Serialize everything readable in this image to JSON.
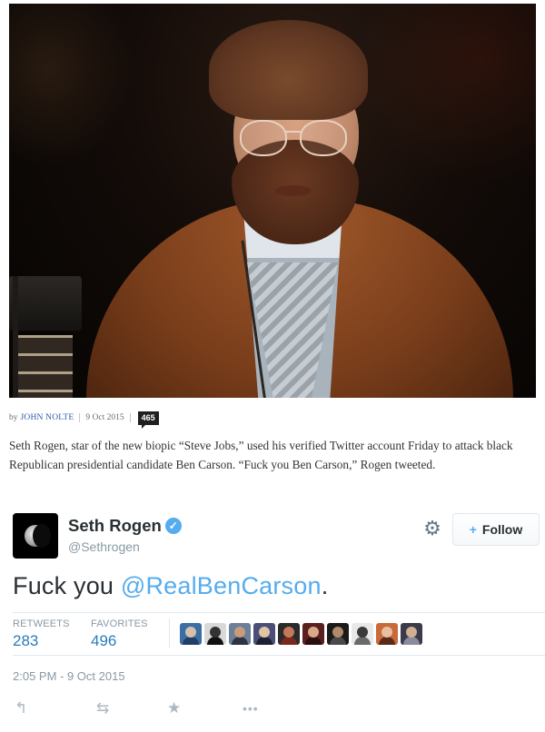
{
  "article": {
    "byline_prefix": "by",
    "author": "JOHN NOLTE",
    "date": "9 Oct 2015",
    "comment_count": "465",
    "body": "Seth Rogen, star of the new biopic “Steve Jobs,” used his verified Twitter account Friday to attack black Republican presidential candidate Ben Carson. “Fuck you Ben Carson,” Rogen tweeted."
  },
  "tweet": {
    "display_name": "Seth Rogen",
    "verified_glyph": "✓",
    "handle": "@Sethrogen",
    "follow_label": "Follow",
    "follow_icon": "+",
    "gear_glyph": "⚙",
    "text_before": "Fuck you ",
    "mention": "@RealBenCarson",
    "text_after": ".",
    "retweets_label": "RETWEETS",
    "retweets": "283",
    "favorites_label": "FAVORITES",
    "favorites": "496",
    "timestamp": "2:05 PM - 9 Oct 2015",
    "actions": {
      "reply_glyph": "↰",
      "retweet_glyph": "⇆",
      "favorite_glyph": "★",
      "more_glyph": "•••"
    }
  },
  "favoriter_avatars": [
    {
      "name": "favoriter-avatar-1",
      "bg": "#3a6ea5",
      "head": "#d8c0a8",
      "body": "#1f3f66"
    },
    {
      "name": "favoriter-avatar-2",
      "bg": "#d9d9d9",
      "head": "#333333",
      "body": "#111111"
    },
    {
      "name": "favoriter-avatar-3",
      "bg": "#6b7f99",
      "head": "#c99b7a",
      "body": "#2b3440"
    },
    {
      "name": "favoriter-avatar-4",
      "bg": "#4a4f7a",
      "head": "#e0c4a4",
      "body": "#1d2033"
    },
    {
      "name": "favoriter-avatar-5",
      "bg": "#2b2b2b",
      "head": "#c47a5a",
      "body": "#7a2a1a"
    },
    {
      "name": "favoriter-avatar-6",
      "bg": "#5a1f1f",
      "head": "#d8a888",
      "body": "#2a0f0f"
    },
    {
      "name": "favoriter-avatar-7",
      "bg": "#1a1a1a",
      "head": "#b08a6a",
      "body": "#4a4a4a"
    },
    {
      "name": "favoriter-avatar-8",
      "bg": "#e8e8e8",
      "head": "#3a3a3a",
      "body": "#6a6a6a"
    },
    {
      "name": "favoriter-avatar-9",
      "bg": "#c86a3a",
      "head": "#e8c0a0",
      "body": "#5a2a1a"
    },
    {
      "name": "favoriter-avatar-10",
      "bg": "#3a3a4a",
      "head": "#d0b090",
      "body": "#8a8aa0"
    }
  ],
  "colors": {
    "twitter_blue": "#55acee",
    "link_blue": "#2b7bb9",
    "muted": "#8899a6",
    "jacket": "#8b4a22"
  }
}
